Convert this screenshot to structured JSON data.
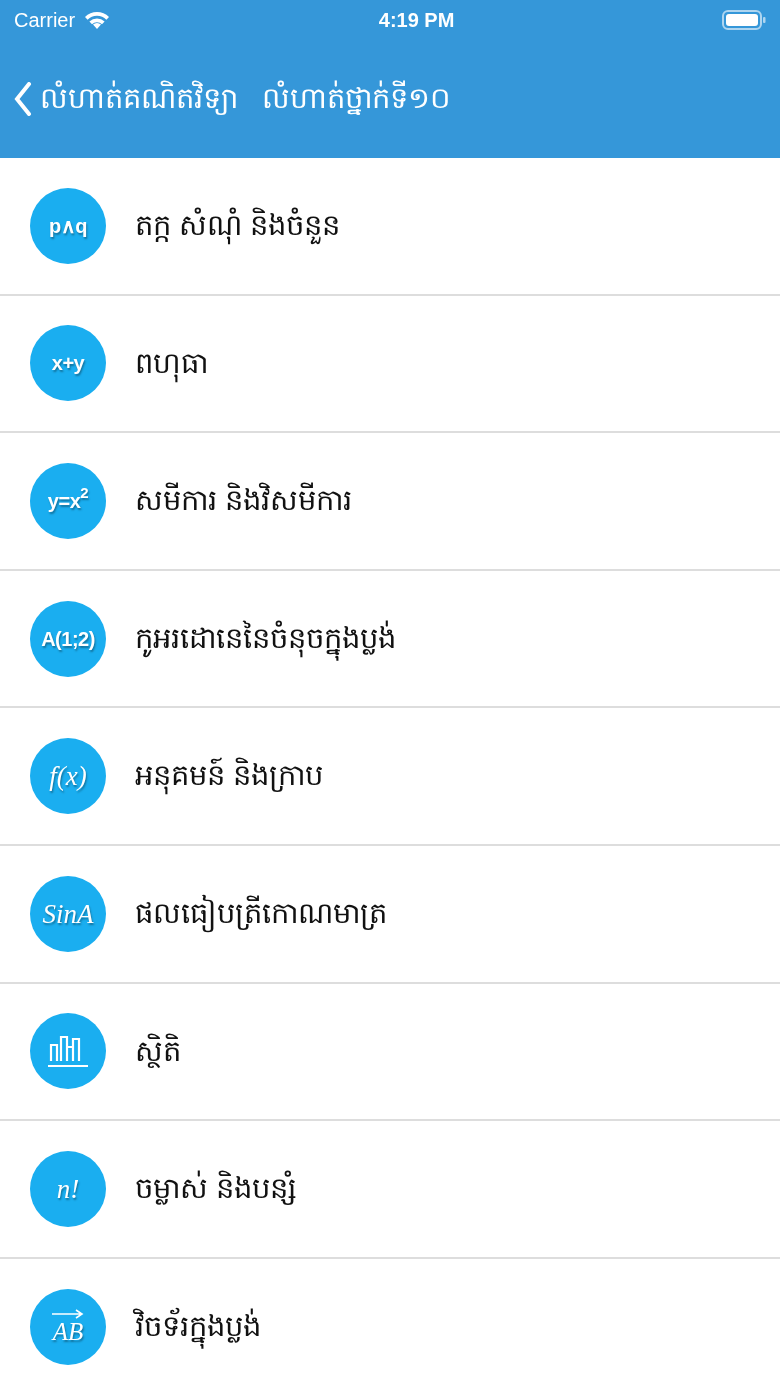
{
  "status_bar": {
    "carrier": "Carrier",
    "time": "4:19 PM"
  },
  "nav_bar": {
    "back_label": "លំហាត់គណិតវិទ្យា",
    "title": "លំហាត់ថ្នាក់ទី១០"
  },
  "items": [
    {
      "kind": "formula",
      "icon_text": "p∧q",
      "label": "តក្ក សំណុំ និងចំនួន"
    },
    {
      "kind": "formula",
      "icon_text": "x+y",
      "label": "ពហុធា"
    },
    {
      "kind": "formula",
      "icon_text": "y=x$^{2}$",
      "label": "សមីការ និងវិសមីការ"
    },
    {
      "kind": "formula",
      "icon_text": "A(1;2)",
      "label": "កូអរដោនេនៃចំនុចក្នុងប្លង់"
    },
    {
      "kind": "script",
      "icon_text": "f(x)",
      "label": "អនុគមន៍ និងក្រាប"
    },
    {
      "kind": "script",
      "icon_text": "SinA",
      "label": "ផលធៀបត្រីកោណមាត្រ"
    },
    {
      "kind": "chart",
      "label": "ស្ថិតិ"
    },
    {
      "kind": "script",
      "icon_text": "n!",
      "label": "ចម្លាស់ និងបន្សំ"
    },
    {
      "kind": "vector",
      "icon_text": "AB",
      "label": "វិចទ័រក្នុងប្លង់"
    }
  ]
}
